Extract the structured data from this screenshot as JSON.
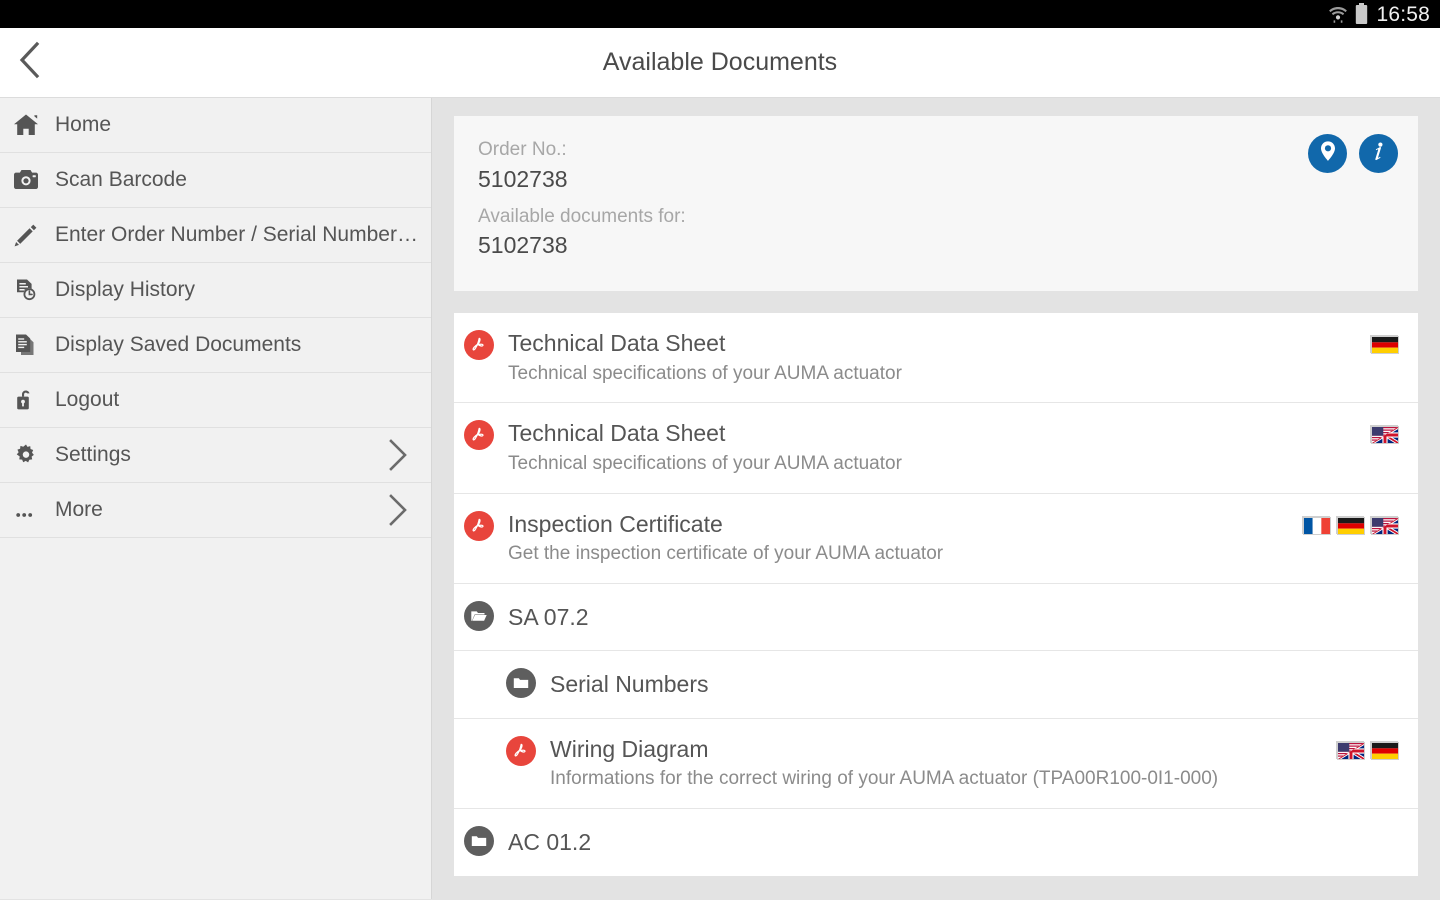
{
  "status_bar": {
    "time": "16:58",
    "icons": [
      "wifi-icon",
      "battery-icon"
    ]
  },
  "header": {
    "title": "Available Documents",
    "back_icon": "chevron-left-icon"
  },
  "sidebar": {
    "items": [
      {
        "label": "Home",
        "icon": "home-icon",
        "chevron": false
      },
      {
        "label": "Scan Barcode",
        "icon": "camera-icon",
        "chevron": false
      },
      {
        "label": "Enter Order Number / Serial Number…",
        "icon": "pencil-icon",
        "chevron": false
      },
      {
        "label": "Display History",
        "icon": "document-clock-icon",
        "chevron": false
      },
      {
        "label": "Display Saved Documents",
        "icon": "documents-stack-icon",
        "chevron": false
      },
      {
        "label": "Logout",
        "icon": "lock-open-icon",
        "chevron": false
      },
      {
        "label": "Settings",
        "icon": "gear-icon",
        "chevron": true
      },
      {
        "label": "More",
        "icon": "ellipsis-icon",
        "chevron": true
      }
    ]
  },
  "order_card": {
    "order_no_label": "Order No.:",
    "order_no_value": "5102738",
    "available_for_label": "Available documents for:",
    "available_for_value": "5102738",
    "actions": [
      {
        "name": "location-pin-icon",
        "label": "Location"
      },
      {
        "name": "info-icon",
        "label": "Information"
      }
    ]
  },
  "documents": [
    {
      "title": "Technical Data Sheet",
      "subtitle": "Technical specifications of your AUMA actuator",
      "icon": "pdf-icon",
      "type": "document",
      "indent": false,
      "flags": [
        "de"
      ]
    },
    {
      "title": "Technical Data Sheet",
      "subtitle": "Technical specifications of your AUMA actuator",
      "icon": "pdf-icon",
      "type": "document",
      "indent": false,
      "flags": [
        "en"
      ]
    },
    {
      "title": "Inspection Certificate",
      "subtitle": "Get the inspection certificate of your AUMA actuator",
      "icon": "pdf-icon",
      "type": "document",
      "indent": false,
      "flags": [
        "fr",
        "de",
        "en"
      ]
    },
    {
      "title": "SA 07.2",
      "subtitle": "",
      "icon": "folder-open-icon",
      "type": "folder",
      "indent": false,
      "flags": []
    },
    {
      "title": "Serial Numbers",
      "subtitle": "",
      "icon": "folder-icon",
      "type": "folder",
      "indent": true,
      "flags": []
    },
    {
      "title": "Wiring Diagram",
      "subtitle": "Informations for the correct wiring of your AUMA actuator (TPA00R100-0I1-000)",
      "icon": "pdf-icon",
      "type": "document",
      "indent": true,
      "flags": [
        "en",
        "de"
      ]
    },
    {
      "title": "AC 01.2",
      "subtitle": "",
      "icon": "folder-icon",
      "type": "folder",
      "indent": false,
      "flags": []
    }
  ],
  "colors": {
    "accent_blue": "#1168ab",
    "pdf_red": "#e8453c",
    "folder_gray": "#5e5e5e",
    "page_bg": "#e3e3e3",
    "sidebar_bg": "#f1f1f1",
    "card_bg": "#f7f7f7"
  }
}
